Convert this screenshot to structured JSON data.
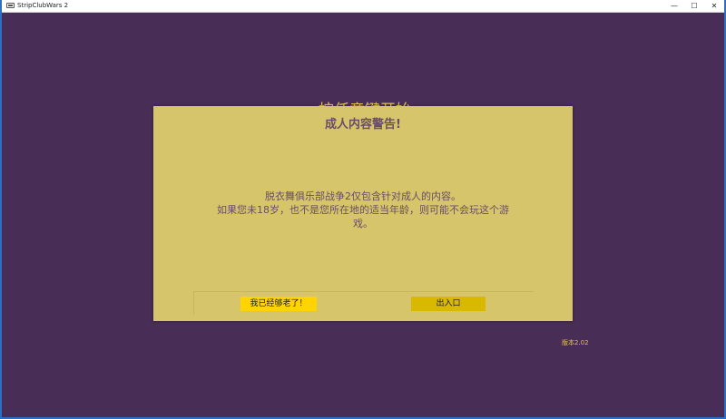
{
  "window": {
    "title": "StripClubWars 2",
    "controls": {
      "minimize": "—",
      "maximize": "☐",
      "close": "✕"
    }
  },
  "background_text": "按任意键开始",
  "modal": {
    "title": "成人内容警告!",
    "body_lines": [
      "脱衣舞俱乐部战争2仅包含针对成人的内容。",
      "如果您未18岁，也不是您所在地的适当年龄，则可能不会玩这个游",
      "戏。"
    ],
    "confirm_label": "我已经够老了！",
    "exit_label": "出入口"
  },
  "version": "版本2.02",
  "colors": {
    "background": "#482d56",
    "modal": "#d6c56a",
    "accent_text": "#e6c24a",
    "confirm_button": "#ffd400",
    "exit_button": "#d8b900"
  }
}
